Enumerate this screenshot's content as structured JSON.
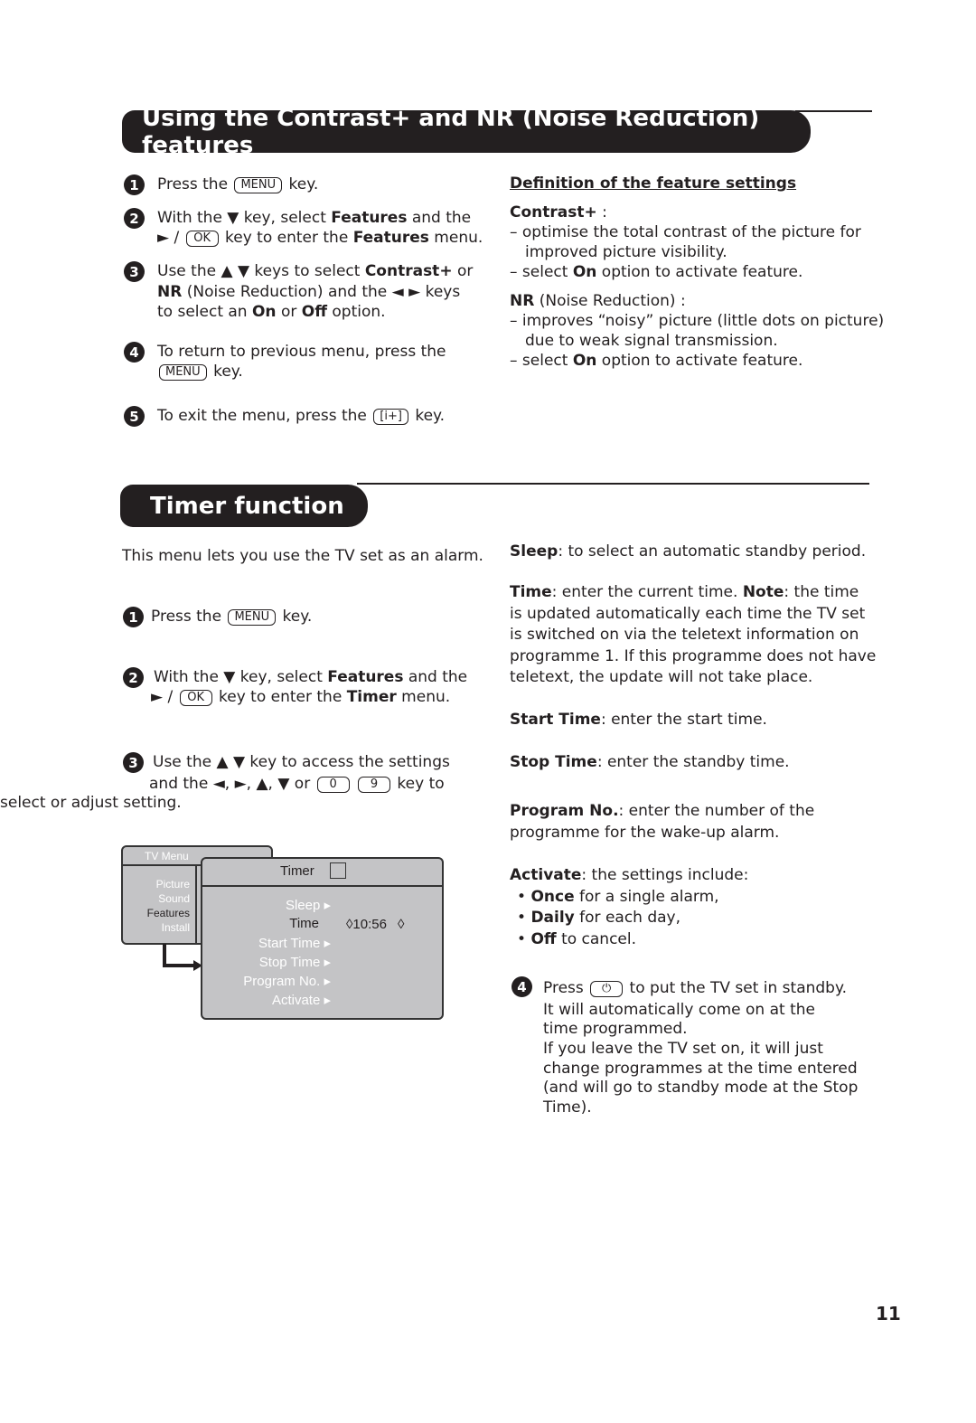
{
  "section1": {
    "title": "Using the Contrast+ and NR (Noise Reduction) features",
    "steps": [
      {
        "num": "1",
        "lines": [
          [
            {
              "t": "Press the "
            },
            {
              "t": "MENU",
              "s": "k"
            },
            {
              "t": " key."
            }
          ]
        ]
      },
      {
        "num": "2",
        "lines": [
          [
            {
              "t": "With the ▼ key, select "
            },
            {
              "t": "Features",
              "s": "b"
            },
            {
              "t": " and the"
            }
          ],
          [
            {
              "t": "► / "
            },
            {
              "t": "OK",
              "s": "k"
            },
            {
              "t": " key to enter the "
            },
            {
              "t": "Features",
              "s": "b"
            },
            {
              "t": " menu."
            }
          ]
        ]
      },
      {
        "num": "3",
        "lines": [
          [
            {
              "t": "Use the ▲ ▼ keys to select "
            },
            {
              "t": "Contrast+",
              "s": "b"
            },
            {
              "t": " or"
            }
          ],
          [
            {
              "t": "NR",
              "s": "b"
            },
            {
              "t": " (Noise Reduction) and the ◄  ► keys"
            }
          ],
          [
            {
              "t": "to select an "
            },
            {
              "t": "On",
              "s": "b"
            },
            {
              "t": " or "
            },
            {
              "t": "Off",
              "s": "b"
            },
            {
              "t": " option."
            }
          ]
        ]
      },
      {
        "num": "4",
        "lines": [
          [
            {
              "t": "To return to previous menu, press the"
            }
          ],
          [
            {
              "t": "MENU",
              "s": "k"
            },
            {
              "t": " key."
            }
          ]
        ]
      },
      {
        "num": "5",
        "lines": [
          [
            {
              "t": "To exit the menu, press the  "
            },
            {
              "t": "[i+]",
              "s": "k"
            },
            {
              "t": "  key."
            }
          ]
        ]
      }
    ],
    "definitions": [
      [
        {
          "t": "Definition of the feature settings",
          "s": "u"
        }
      ],
      [
        {
          "t": "Contrast+",
          "s": "b"
        },
        {
          "t": " :"
        }
      ],
      [
        {
          "t": "– optimise the total contrast of the picture for"
        }
      ],
      [
        {
          "t": "improved picture visibility."
        }
      ],
      [
        {
          "t": "– select "
        },
        {
          "t": "On",
          "s": "b"
        },
        {
          "t": " option to activate feature."
        }
      ],
      [
        {
          "t": "NR",
          "s": "b"
        },
        {
          "t": " (Noise Reduction) :"
        }
      ],
      [
        {
          "t": "– improves “noisy” picture (little dots on picture)"
        }
      ],
      [
        {
          "t": "due to weak signal transmission."
        }
      ],
      [
        {
          "t": "– select "
        },
        {
          "t": "On",
          "s": "b"
        },
        {
          "t": " option to activate feature."
        }
      ]
    ]
  },
  "section2": {
    "title": "Timer function",
    "intro": [
      [
        {
          "t": "This menu lets you use the TV set as an alarm."
        }
      ]
    ],
    "steps": [
      {
        "num": "1",
        "lines": [
          [
            {
              "t": "Press the "
            },
            {
              "t": "MENU",
              "s": "k"
            },
            {
              "t": "  key."
            }
          ]
        ]
      },
      {
        "num": "2",
        "lines": [
          [
            {
              "t": "With the ▼ key, select "
            },
            {
              "t": "Features",
              "s": "b"
            },
            {
              "t": " and the"
            }
          ],
          [
            {
              "t": "► / "
            },
            {
              "t": "OK",
              "s": "k"
            },
            {
              "t": " key to enter the "
            },
            {
              "t": "Timer",
              "s": "b"
            },
            {
              "t": " menu."
            }
          ]
        ]
      },
      {
        "num": "3",
        "lines": [
          [
            {
              "t": "Use the ▲ ▼ key to access the settings"
            }
          ],
          [
            {
              "t": "and the ◄,  ►, ▲, ▼ or "
            },
            {
              "t": "0",
              "s": "k"
            },
            {
              "t": " "
            },
            {
              "t": "9",
              "s": "k"
            },
            {
              "t": " key to"
            }
          ],
          [
            {
              "t": "select or adjust setting."
            }
          ]
        ]
      }
    ],
    "right": [
      [
        {
          "t": "Sleep",
          "s": "b"
        },
        {
          "t": ": to select an automatic standby period."
        }
      ],
      [
        {
          "t": "Time",
          "s": "b"
        },
        {
          "t": ": enter the current time. "
        },
        {
          "t": "Note",
          "s": "b"
        },
        {
          "t": ": the time"
        }
      ],
      [
        {
          "t": "is updated automatically each time the TV set"
        }
      ],
      [
        {
          "t": "is switched on via the teletext information on"
        }
      ],
      [
        {
          "t": "programme 1. If this programme does not have"
        }
      ],
      [
        {
          "t": "teletext, the update will not take place."
        }
      ],
      [
        {
          "t": "Start Time",
          "s": "b"
        },
        {
          "t": ": enter the start time."
        }
      ],
      [
        {
          "t": "Stop Time",
          "s": "b"
        },
        {
          "t": ": enter the standby time."
        }
      ],
      [
        {
          "t": "Program No.",
          "s": "b"
        },
        {
          "t": ": enter the number of the"
        }
      ],
      [
        {
          "t": "programme for the wake-up alarm."
        }
      ],
      [
        {
          "t": "Activate",
          "s": "b"
        },
        {
          "t": ": the settings include:"
        }
      ],
      [
        {
          "t": "•     "
        },
        {
          "t": "Once",
          "s": "b"
        },
        {
          "t": " for a single alarm,"
        }
      ],
      [
        {
          "t": "•     "
        },
        {
          "t": "Daily",
          "s": "b"
        },
        {
          "t": " for each day,"
        }
      ],
      [
        {
          "t": "•     "
        },
        {
          "t": "Off",
          "s": "b"
        },
        {
          "t": " to cancel."
        }
      ]
    ],
    "step4": {
      "num": "4",
      "lines": [
        [
          {
            "t": "Press "
          },
          {
            "t": "⏻",
            "s": "k"
          },
          {
            "t": "  to put the TV set in standby."
          }
        ],
        [
          {
            "t": "It will automatically come on at the"
          }
        ],
        [
          {
            "t": "time programmed."
          }
        ],
        [
          {
            "t": "If you leave the TV set on, it will just"
          }
        ],
        [
          {
            "t": "change programmes at the time entered"
          }
        ],
        [
          {
            "t": "(and will go to standby mode at the Stop"
          }
        ],
        [
          {
            "t": "Time)."
          }
        ]
      ]
    },
    "menu": {
      "tv_menu_title": "TV Menu",
      "tv_menu_items": [
        "Picture",
        "Sound",
        "Features",
        "Install"
      ],
      "tv_menu_selected": "Features",
      "timer_title": "Timer",
      "timer_items": [
        "Sleep ▸",
        "Time",
        "Start Time ▸",
        "Stop Time ▸",
        "Program No. ▸",
        "Activate ▸"
      ],
      "time_value": "10:56"
    }
  },
  "page_number": "11"
}
